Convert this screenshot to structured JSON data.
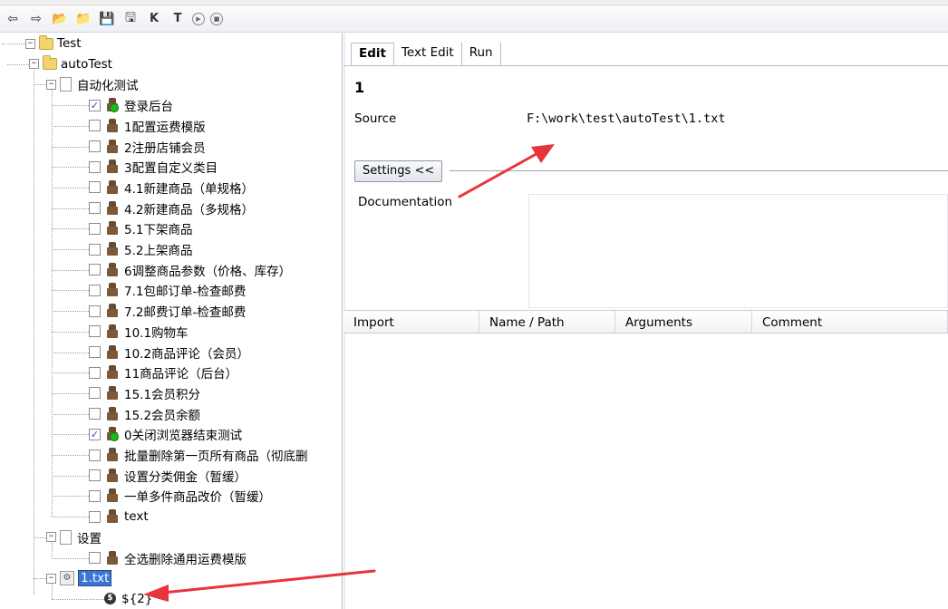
{
  "toolbar": {
    "buttons": [
      {
        "name": "back-icon",
        "glyph": "⇦"
      },
      {
        "name": "forward-icon",
        "glyph": "⇨"
      },
      {
        "name": "open-folder-icon",
        "glyph": "📂"
      },
      {
        "name": "folder-icon",
        "glyph": "📁"
      },
      {
        "name": "save-icon",
        "glyph": "💾"
      },
      {
        "name": "save-all-icon",
        "glyph": "🖫"
      },
      {
        "name": "keyword-search-icon",
        "glyph": "K"
      },
      {
        "name": "test-search-icon",
        "glyph": "T"
      },
      {
        "name": "run-icon",
        "glyph": "▶"
      },
      {
        "name": "stop-icon",
        "glyph": "■"
      }
    ]
  },
  "tree": {
    "root": "Test",
    "project": "autoTest",
    "suite1": {
      "name": "自动化测试",
      "cases": [
        {
          "label": "登录后台",
          "checked": true,
          "passed": true
        },
        {
          "label": "1配置运费模版",
          "checked": false,
          "passed": false
        },
        {
          "label": "2注册店铺会员",
          "checked": false,
          "passed": false
        },
        {
          "label": "3配置自定义类目",
          "checked": false,
          "passed": false
        },
        {
          "label": "4.1新建商品（单规格）",
          "checked": false,
          "passed": false
        },
        {
          "label": "4.2新建商品（多规格）",
          "checked": false,
          "passed": false
        },
        {
          "label": "5.1下架商品",
          "checked": false,
          "passed": false
        },
        {
          "label": "5.2上架商品",
          "checked": false,
          "passed": false
        },
        {
          "label": "6调整商品参数（价格、库存）",
          "checked": false,
          "passed": false
        },
        {
          "label": "7.1包邮订单-检查邮费",
          "checked": false,
          "passed": false
        },
        {
          "label": "7.2邮费订单-检查邮费",
          "checked": false,
          "passed": false
        },
        {
          "label": "10.1购物车",
          "checked": false,
          "passed": false
        },
        {
          "label": "10.2商品评论（会员）",
          "checked": false,
          "passed": false
        },
        {
          "label": "11商品评论（后台）",
          "checked": false,
          "passed": false
        },
        {
          "label": "15.1会员积分",
          "checked": false,
          "passed": false
        },
        {
          "label": "15.2会员余额",
          "checked": false,
          "passed": false
        },
        {
          "label": "0关闭浏览器结束测试",
          "checked": true,
          "passed": true
        },
        {
          "label": "批量删除第一页所有商品（彻底删",
          "checked": false,
          "passed": false
        },
        {
          "label": "设置分类佣金（暂缓）",
          "checked": false,
          "passed": false
        },
        {
          "label": "一单多件商品改价（暂缓）",
          "checked": false,
          "passed": false
        },
        {
          "label": "text",
          "checked": false,
          "passed": false
        }
      ]
    },
    "suite2": {
      "name": "设置",
      "cases": [
        {
          "label": "全选删除通用运费模版",
          "checked": false,
          "passed": false
        }
      ]
    },
    "resource": {
      "name": "1.txt",
      "selected": true
    },
    "variable": {
      "name": "${2}"
    }
  },
  "editor": {
    "tabs": [
      {
        "label": "Edit",
        "active": true
      },
      {
        "label": "Text Edit",
        "active": false
      },
      {
        "label": "Run",
        "active": false
      }
    ],
    "item_title": "1",
    "source_label": "Source",
    "source_value": "F:\\work\\test\\autoTest\\1.txt",
    "settings_button": "Settings <<",
    "documentation_label": "Documentation",
    "documentation_value": "",
    "import_table": {
      "columns": [
        "Import",
        "Name / Path",
        "Arguments",
        "Comment"
      ],
      "rows": []
    }
  },
  "colors": {
    "selection": "#3875d7",
    "annotation_arrow": "#e8343a",
    "status_ok": "#1cb81c"
  }
}
